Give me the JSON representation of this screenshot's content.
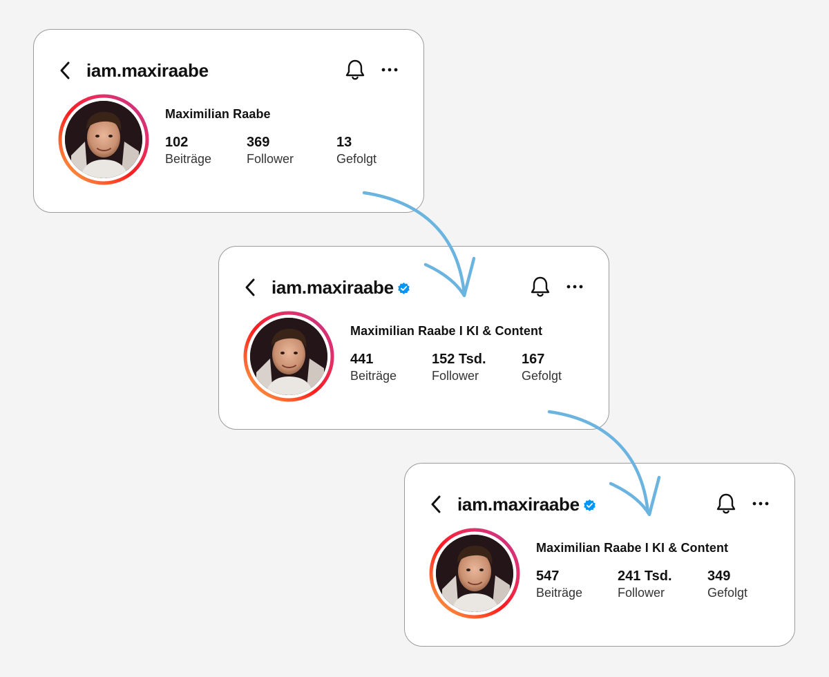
{
  "cards": [
    {
      "username": "iam.maxiraabe",
      "verified": false,
      "display_name": "Maximilian Raabe",
      "stats": [
        {
          "value": "102",
          "label": "Beiträge"
        },
        {
          "value": "369",
          "label": "Follower"
        },
        {
          "value": "13",
          "label": "Gefolgt"
        }
      ]
    },
    {
      "username": "iam.maxiraabe",
      "verified": true,
      "display_name": "Maximilian Raabe I KI & Content",
      "stats": [
        {
          "value": "441",
          "label": "Beiträge"
        },
        {
          "value": "152 Tsd.",
          "label": "Follower"
        },
        {
          "value": "167",
          "label": "Gefolgt"
        }
      ]
    },
    {
      "username": "iam.maxiraabe",
      "verified": true,
      "display_name": "Maximilian Raabe I KI & Content",
      "stats": [
        {
          "value": "547",
          "label": "Beiträge"
        },
        {
          "value": "241 Tsd.",
          "label": "Follower"
        },
        {
          "value": "349",
          "label": "Gefolgt"
        }
      ]
    }
  ],
  "icons": {
    "back": "chevron-left-icon",
    "verified": "verified-badge-icon",
    "notifications": "bell-icon",
    "more": "more-horizontal-icon"
  },
  "colors": {
    "background": "#f4f4f4",
    "card": "#ffffff",
    "verified_badge": "#0095f6",
    "arrow": "#6bb4e0",
    "story_ring_start": "#f09433",
    "story_ring_mid": "#e1306c",
    "story_ring_end": "#c13584"
  }
}
